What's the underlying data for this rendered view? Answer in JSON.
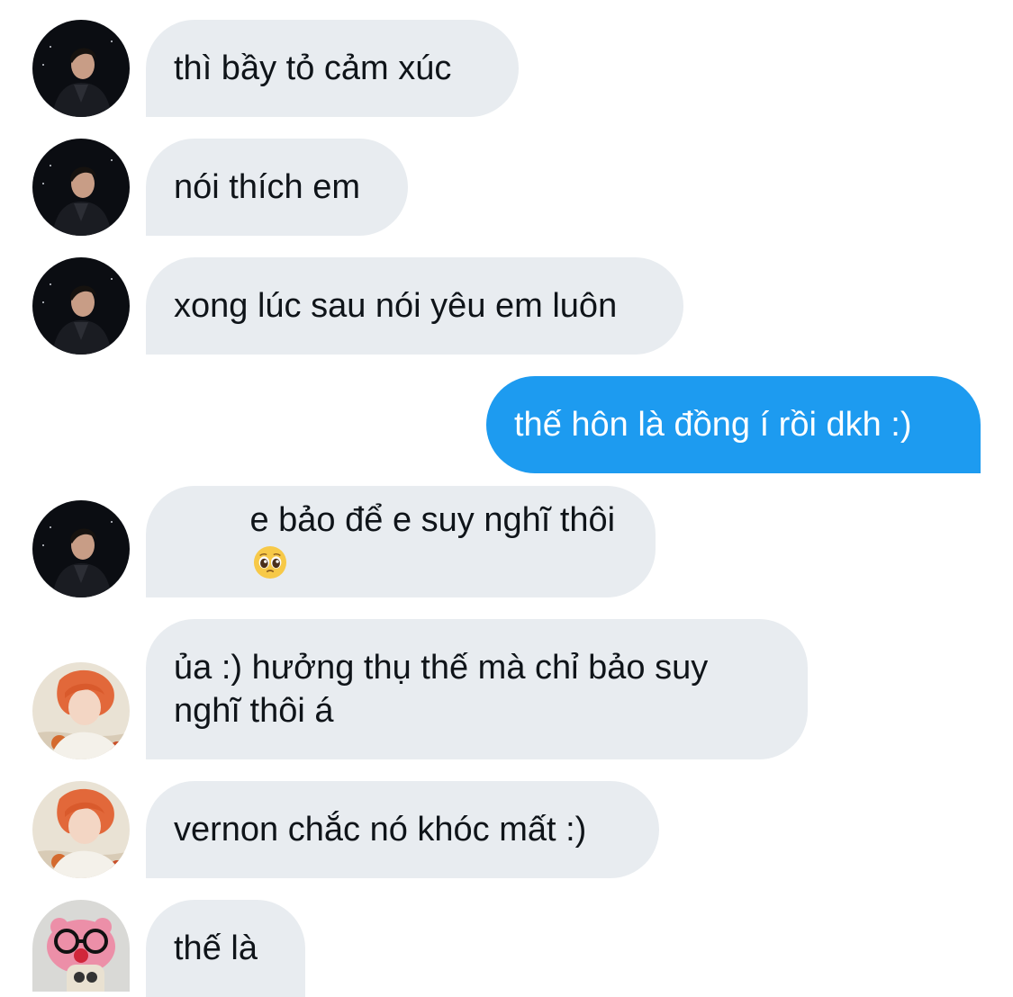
{
  "conversation": {
    "messages": [
      {
        "sender": "other",
        "avatar": "dark-portrait-avatar",
        "text": "thì bầy tỏ cảm xúc"
      },
      {
        "sender": "other",
        "avatar": "dark-portrait-avatar",
        "text": "nói thích em"
      },
      {
        "sender": "other",
        "avatar": "dark-portrait-avatar",
        "text": "xong lúc sau nói yêu em luôn"
      },
      {
        "sender": "me",
        "text": "thế hôn là đồng í rồi dkh :)"
      },
      {
        "sender": "other",
        "avatar": "dark-portrait-avatar",
        "text": "e bảo để e suy nghĩ thôi",
        "emoji": "pleading-face-emoji"
      },
      {
        "sender": "other",
        "avatar": "orange-hair-avatar",
        "text": "ủa :) hưởng thụ thế mà chỉ bảo suy nghĩ thôi á"
      },
      {
        "sender": "other",
        "avatar": "orange-hair-avatar",
        "text": "vernon chắc nó khóc mất :)"
      },
      {
        "sender": "other",
        "avatar": "pink-plush-avatar",
        "text": "thế là"
      }
    ]
  },
  "colors": {
    "incoming_bubble": "#e8ecf0",
    "outgoing_bubble": "#1d9bf0",
    "incoming_text": "#0f1419",
    "outgoing_text": "#ffffff"
  }
}
